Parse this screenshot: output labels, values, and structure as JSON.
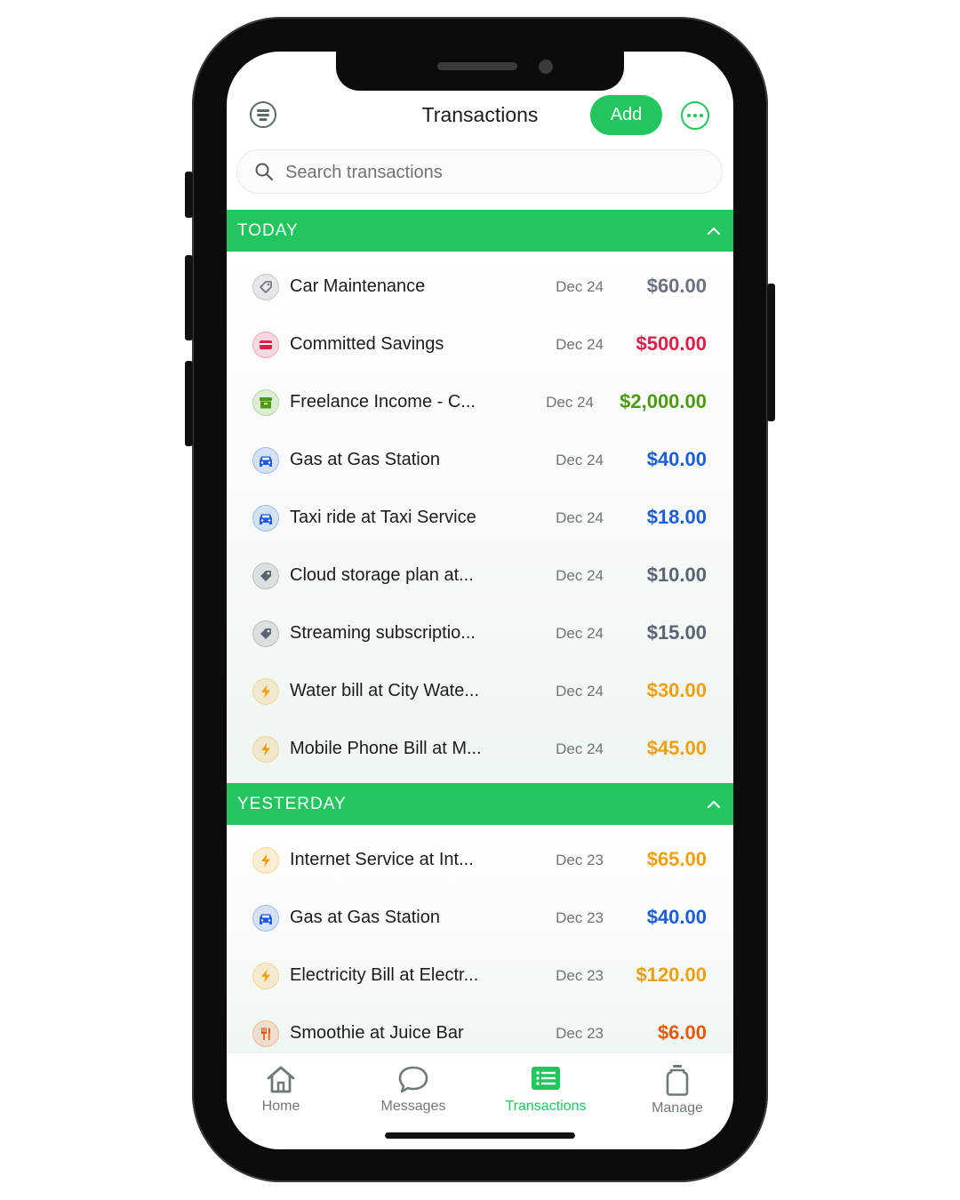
{
  "header": {
    "title": "Transactions",
    "add_label": "Add"
  },
  "search": {
    "placeholder": "Search transactions"
  },
  "sections": [
    {
      "title": "TODAY",
      "rows": [
        {
          "title": "Car Maintenance",
          "date": "Dec 24",
          "amount": "$60.00",
          "icon": "tag-icon",
          "color": "#6b7280"
        },
        {
          "title": "Committed Savings",
          "date": "Dec 24",
          "amount": "$500.00",
          "icon": "credit-card-icon",
          "color": "#e11d48"
        },
        {
          "title": "Freelance Income - C...",
          "date": "Dec 24",
          "amount": "$2,000.00",
          "icon": "archive-box-icon",
          "color": "#4d9a12"
        },
        {
          "title": "Gas at Gas Station",
          "date": "Dec 24",
          "amount": "$40.00",
          "icon": "car-icon",
          "color": "#1d5ed8"
        },
        {
          "title": "Taxi ride at Taxi Service",
          "date": "Dec 24",
          "amount": "$18.00",
          "icon": "car-icon",
          "color": "#1d5ed8"
        },
        {
          "title": "Cloud storage plan at...",
          "date": "Dec 24",
          "amount": "$10.00",
          "icon": "tag-filled-icon",
          "color": "#5b6472"
        },
        {
          "title": "Streaming subscriptio...",
          "date": "Dec 24",
          "amount": "$15.00",
          "icon": "tag-filled-icon",
          "color": "#5b6472"
        },
        {
          "title": "Water bill at City Wate...",
          "date": "Dec 24",
          "amount": "$30.00",
          "icon": "bolt-icon",
          "color": "#f59e0b"
        },
        {
          "title": "Mobile Phone Bill at M...",
          "date": "Dec 24",
          "amount": "$45.00",
          "icon": "bolt-icon",
          "color": "#f59e0b"
        }
      ]
    },
    {
      "title": "YESTERDAY",
      "rows": [
        {
          "title": "Internet Service at Int...",
          "date": "Dec 23",
          "amount": "$65.00",
          "icon": "bolt-icon",
          "color": "#f59e0b"
        },
        {
          "title": "Gas at Gas Station",
          "date": "Dec 23",
          "amount": "$40.00",
          "icon": "car-icon",
          "color": "#1d5ed8"
        },
        {
          "title": "Electricity Bill at Electr...",
          "date": "Dec 23",
          "amount": "$120.00",
          "icon": "bolt-icon",
          "color": "#f59e0b"
        },
        {
          "title": "Smoothie at Juice Bar",
          "date": "Dec 23",
          "amount": "$6.00",
          "icon": "fork-knife-icon",
          "color": "#ea580c"
        }
      ]
    }
  ],
  "tabs": [
    {
      "label": "Home",
      "icon": "home-icon"
    },
    {
      "label": "Messages",
      "icon": "chat-bubble-icon"
    },
    {
      "label": "Transactions",
      "icon": "list-icon"
    },
    {
      "label": "Manage",
      "icon": "jar-icon"
    }
  ],
  "colors": {
    "accent": "#22c55e",
    "text": "#1c1c1c",
    "muted": "#6e7571"
  }
}
